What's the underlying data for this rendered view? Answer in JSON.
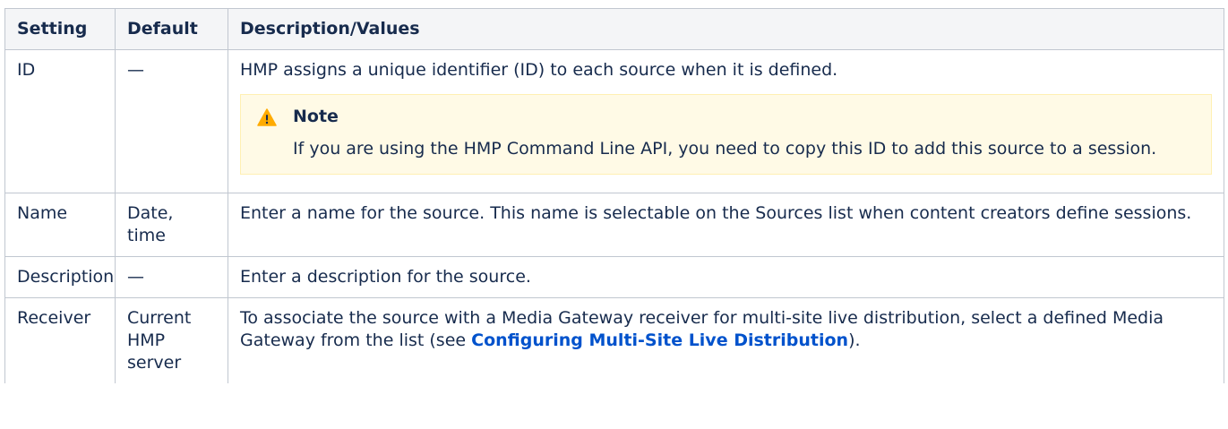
{
  "headers": {
    "setting": "Setting",
    "default": "Default",
    "description": "Description/Values"
  },
  "rows": {
    "id": {
      "setting": "ID",
      "default": "—",
      "description": "HMP assigns a unique identifier (ID) to each source when it is defined.",
      "note": {
        "title": "Note",
        "body": "If you are using the HMP Command Line API, you need to copy this ID to add this source to a session.",
        "icon": "warning-icon",
        "background_color": "#fffae6",
        "icon_color": "#ffab00"
      }
    },
    "name": {
      "setting": "Name",
      "default": "Date, time",
      "description": "Enter a name for the source. This name is selectable on the Sources list when content creators define sessions."
    },
    "description": {
      "setting": "Description",
      "default": "—",
      "description": "Enter a description for the source."
    },
    "receiver": {
      "setting": "Receiver",
      "default": "Current HMP server",
      "description_before": "To associate the source with a Media Gateway receiver for multi-site live distribution, select a defined Media Gateway from the list (see ",
      "description_link": "Configuring Multi-Site Live Distribution",
      "description_after": ")."
    }
  },
  "colors": {
    "header_bg": "#f4f5f7",
    "border": "#c1c7d0",
    "link": "#0052cc",
    "text": "#172b4d"
  }
}
